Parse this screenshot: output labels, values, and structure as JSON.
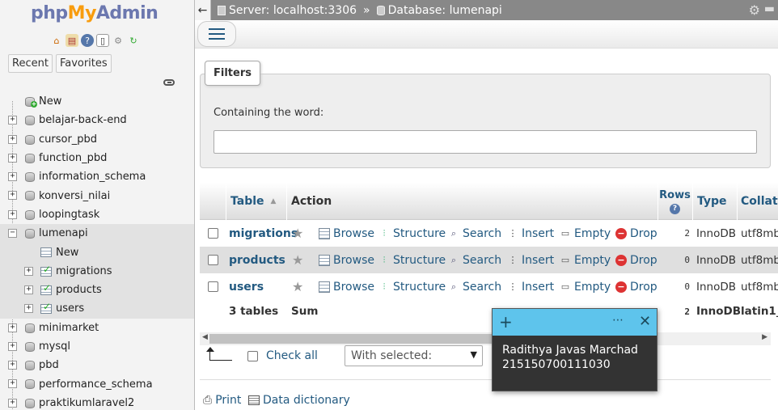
{
  "nav": {
    "logo": {
      "php": "php",
      "my": "My",
      "admin": "Admin"
    },
    "icons": [
      "home-icon",
      "server-icon",
      "help-icon",
      "docs-icon",
      "settings-icon",
      "reload-icon"
    ],
    "tabs": [
      "Recent",
      "Favorites"
    ],
    "tree": [
      {
        "label": "New",
        "type": "new",
        "level": 0
      },
      {
        "label": "belajar-back-end",
        "type": "db",
        "level": 0
      },
      {
        "label": "cursor_pbd",
        "type": "db",
        "level": 0
      },
      {
        "label": "function_pbd",
        "type": "db",
        "level": 0
      },
      {
        "label": "information_schema",
        "type": "db",
        "level": 0
      },
      {
        "label": "konversi_nilai",
        "type": "db",
        "level": 0
      },
      {
        "label": "loopingtask",
        "type": "db",
        "level": 0
      },
      {
        "label": "lumenapi",
        "type": "db-open",
        "level": 0
      },
      {
        "label": "New",
        "type": "table-new",
        "level": 1
      },
      {
        "label": "migrations",
        "type": "table",
        "level": 1
      },
      {
        "label": "products",
        "type": "table",
        "level": 1
      },
      {
        "label": "users",
        "type": "table",
        "level": 1
      },
      {
        "label": "minimarket",
        "type": "db",
        "level": 0
      },
      {
        "label": "mysql",
        "type": "db",
        "level": 0
      },
      {
        "label": "pbd",
        "type": "db",
        "level": 0
      },
      {
        "label": "performance_schema",
        "type": "db",
        "level": 0
      },
      {
        "label": "praktikumlaravel2",
        "type": "db",
        "level": 0
      }
    ]
  },
  "breadcrumb": {
    "back": "←",
    "server": "Server: localhost:3306",
    "separator": "»",
    "database": "Database: lumenapi"
  },
  "filters": {
    "legend": "Filters",
    "label": "Containing the word:",
    "value": ""
  },
  "table": {
    "headers": {
      "table": "Table",
      "action": "Action",
      "rows": "Rows",
      "type": "Type",
      "collation": "Collat"
    },
    "actions": [
      "Browse",
      "Structure",
      "Search",
      "Insert",
      "Empty",
      "Drop"
    ],
    "rows": [
      {
        "name": "migrations",
        "rows": "2",
        "type": "InnoDB",
        "collation": "utf8mb"
      },
      {
        "name": "products",
        "rows": "0",
        "type": "InnoDB",
        "collation": "utf8mb"
      },
      {
        "name": "users",
        "rows": "0",
        "type": "InnoDB",
        "collation": "utf8mb"
      }
    ],
    "footer": {
      "count": "3 tables",
      "sum": "Sum",
      "rows": "2",
      "type": "InnoDB",
      "collation": "latin1_"
    }
  },
  "bulk": {
    "check_all": "Check all",
    "with_selected": "With selected:"
  },
  "links": {
    "print": "Print",
    "data_dictionary": "Data dictionary"
  },
  "sticky_note": {
    "line1": "Radithya Javas Marchad",
    "line2": "215150700111030",
    "accent": "#5ec4ec"
  },
  "colors": {
    "link": "#235a81",
    "logo_blue": "#6c78af",
    "logo_orange": "#f89c0e"
  }
}
